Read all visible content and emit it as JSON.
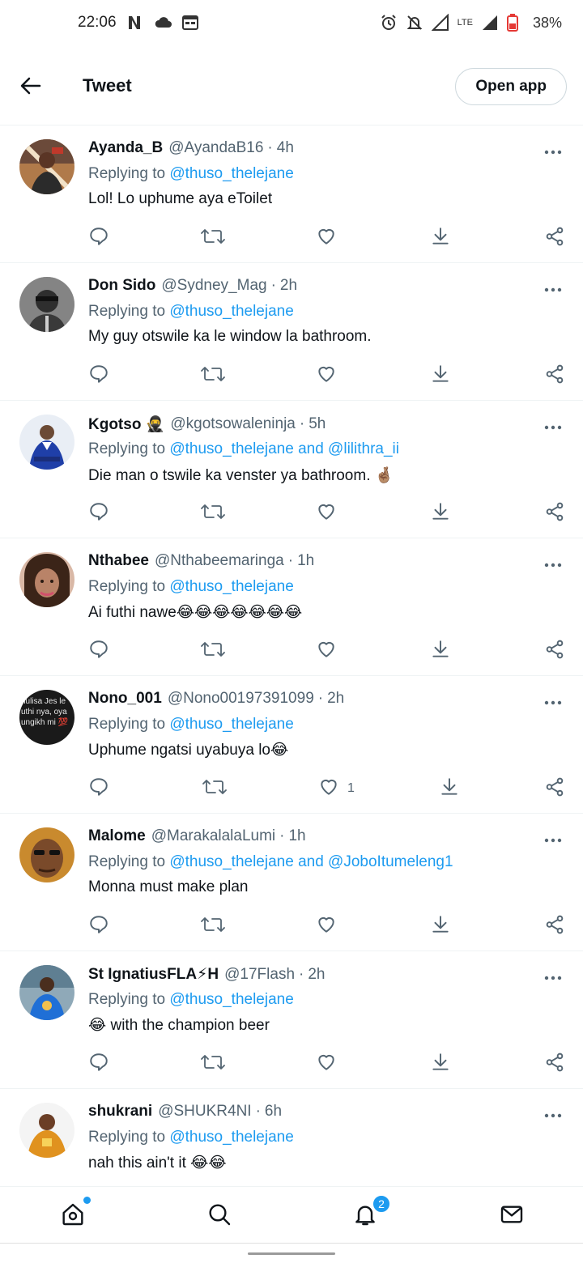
{
  "status_bar": {
    "time": "22:06",
    "left_icons": [
      "netflix-n-icon",
      "cloud-icon",
      "calendar-icon"
    ],
    "right_icons": [
      "alarm-icon",
      "mute-icon",
      "signal-icon",
      "lte-icon",
      "signal-icon",
      "battery-icon"
    ],
    "network": "LTE",
    "battery": "38%"
  },
  "header": {
    "title": "Tweet",
    "open_app_label": "Open app"
  },
  "colors": {
    "accent": "#1d9bf0",
    "text": "#0f1419",
    "secondary_text": "#536471",
    "divider": "#eff3f4"
  },
  "replies": [
    {
      "name": "Ayanda_B",
      "handle": "@AyandaB16",
      "time": "4h",
      "replying_prefix": "Replying to ",
      "replying_to": "@thuso_thelejane",
      "text": "Lol! Lo uphume aya eToilet",
      "like_count": ""
    },
    {
      "name": "Don Sido",
      "handle": "@Sydney_Mag",
      "time": "2h",
      "replying_prefix": "Replying to ",
      "replying_to": "@thuso_thelejane",
      "text": "My guy otswile ka le window la bathroom.",
      "like_count": ""
    },
    {
      "name": "Kgotso 🥷",
      "handle": "@kgotsowaleninja",
      "time": "5h",
      "replying_prefix": "Replying to ",
      "replying_to": "@thuso_thelejane and @lilithra_ii",
      "text": "Die man o tswile ka venster ya bathroom. 🤞🏽",
      "like_count": ""
    },
    {
      "name": "Nthabee",
      "handle": "@Nthabeemaringa",
      "time": "1h",
      "replying_prefix": "Replying to ",
      "replying_to": "@thuso_thelejane",
      "text": "Ai futhi nawe😂😂😂😂😂😂😂",
      "like_count": ""
    },
    {
      "name": "Nono_001",
      "handle": "@Nono00197391099",
      "time": "2h",
      "replying_prefix": "Replying to ",
      "replying_to": "@thuso_thelejane",
      "text": "Uphume ngatsi uyabuya lo😂",
      "like_count": "1"
    },
    {
      "name": "Malome",
      "handle": "@MarakalalaLumi",
      "time": "1h",
      "replying_prefix": "Replying to ",
      "replying_to": "@thuso_thelejane and @JoboItumeleng1",
      "text": "Monna must make plan",
      "like_count": ""
    },
    {
      "name": "St IgnatiusFLA⚡H",
      "handle": "@17Flash",
      "time": "2h",
      "replying_prefix": "Replying to ",
      "replying_to": "@thuso_thelejane",
      "text": "😂 with the champion beer",
      "like_count": ""
    },
    {
      "name": "shukrani",
      "handle": "@SHUKR4NI",
      "time": "6h",
      "replying_prefix": "Replying to ",
      "replying_to": "@thuso_thelejane",
      "text": "nah this ain't it 😂😂",
      "like_count": ""
    }
  ],
  "avatar_caption_nono": "hulisa Jes le uthi nya, oya ungikh mi 💯",
  "bottom_nav": {
    "items": [
      "home-icon",
      "search-icon",
      "notifications-icon",
      "messages-icon"
    ],
    "notifications_badge": "2"
  }
}
